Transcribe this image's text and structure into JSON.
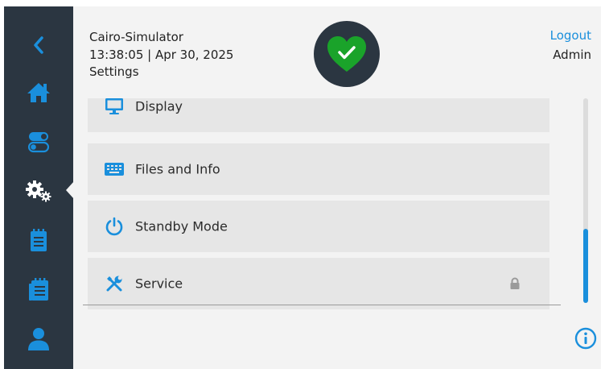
{
  "header": {
    "app_name": "Cairo-Simulator",
    "datetime": "13:38:05 | Apr 30, 2025",
    "page_title": "Settings",
    "status_icon": "heart-check-icon",
    "status_color": "#1aa32a"
  },
  "user": {
    "logout_label": "Logout",
    "role": "Admin"
  },
  "sidebar": {
    "items": [
      {
        "name": "back",
        "icon": "chevron-left-icon",
        "active": false
      },
      {
        "name": "home",
        "icon": "home-icon",
        "active": false
      },
      {
        "name": "toggles",
        "icon": "toggle-icon",
        "active": false
      },
      {
        "name": "settings",
        "icon": "gears-icon",
        "active": true
      },
      {
        "name": "notes",
        "icon": "notepad-icon",
        "active": false
      },
      {
        "name": "calendar",
        "icon": "calendar-list-icon",
        "active": false
      },
      {
        "name": "user",
        "icon": "user-icon",
        "active": false
      }
    ]
  },
  "menu": {
    "items": [
      {
        "label": "Display",
        "icon": "monitor-icon",
        "locked": false
      },
      {
        "label": "Files and Info",
        "icon": "keyboard-icon",
        "locked": false
      },
      {
        "label": "Standby Mode",
        "icon": "power-icon",
        "locked": false
      },
      {
        "label": "Service",
        "icon": "tools-icon",
        "locked": true
      }
    ]
  },
  "scroll": {
    "position_fraction": 0.64
  },
  "colors": {
    "sidebar_bg": "#2b3641",
    "accent": "#1a8fdc",
    "status_green": "#1aa32a",
    "main_bg": "#f3f3f3",
    "item_bg": "#e6e6e6"
  }
}
